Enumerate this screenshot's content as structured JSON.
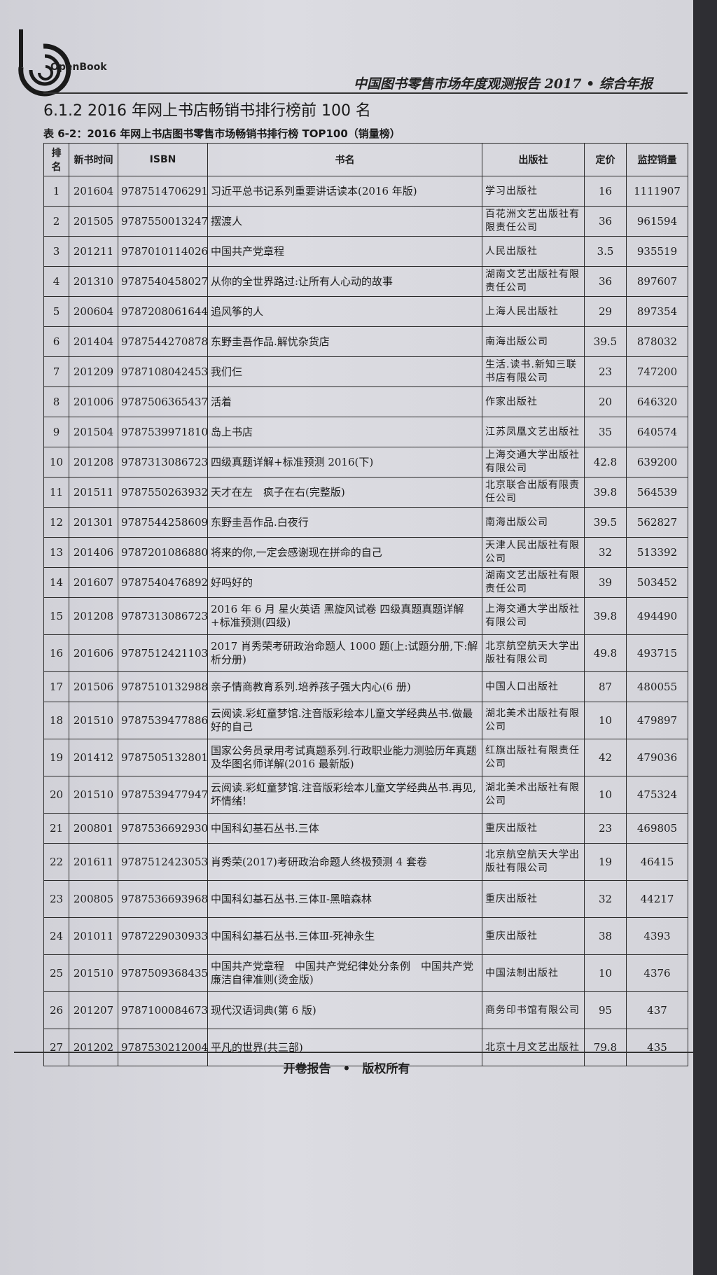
{
  "header": {
    "logo_text": "OpenBook",
    "report_title": "中国图书零售市场年度观测报告 2017 • 综合年报"
  },
  "section_title": "6.1.2 2016 年网上书店畅销书排行榜前 100 名",
  "table_caption": "表 6-2：2016 年网上书店图书零售市场畅销书排行榜 TOP100（销量榜）",
  "columns": [
    "排名",
    "新书时间",
    "ISBN",
    "书名",
    "出版社",
    "定价",
    "监控销量"
  ],
  "rows": [
    {
      "rank": "1",
      "date": "201604",
      "isbn": "9787514706291",
      "title": "习近平总书记系列重要讲话读本(2016 年版)",
      "publisher": "学习出版社",
      "price": "16",
      "sales": "1111907"
    },
    {
      "rank": "2",
      "date": "201505",
      "isbn": "9787550013247",
      "title": "摆渡人",
      "publisher": "百花洲文艺出版社有限责任公司",
      "price": "36",
      "sales": "961594"
    },
    {
      "rank": "3",
      "date": "201211",
      "isbn": "9787010114026",
      "title": "中国共产党章程",
      "publisher": "人民出版社",
      "price": "3.5",
      "sales": "935519"
    },
    {
      "rank": "4",
      "date": "201310",
      "isbn": "9787540458027",
      "title": "从你的全世界路过:让所有人心动的故事",
      "publisher": "湖南文艺出版社有限责任公司",
      "price": "36",
      "sales": "897607"
    },
    {
      "rank": "5",
      "date": "200604",
      "isbn": "9787208061644",
      "title": "追风筝的人",
      "publisher": "上海人民出版社",
      "price": "29",
      "sales": "897354"
    },
    {
      "rank": "6",
      "date": "201404",
      "isbn": "9787544270878",
      "title": "东野圭吾作品.解忧杂货店",
      "publisher": "南海出版公司",
      "price": "39.5",
      "sales": "878032"
    },
    {
      "rank": "7",
      "date": "201209",
      "isbn": "9787108042453",
      "title": "我们仨",
      "publisher": "生活.读书.新知三联书店有限公司",
      "price": "23",
      "sales": "747200"
    },
    {
      "rank": "8",
      "date": "201006",
      "isbn": "9787506365437",
      "title": "活着",
      "publisher": "作家出版社",
      "price": "20",
      "sales": "646320"
    },
    {
      "rank": "9",
      "date": "201504",
      "isbn": "9787539971810",
      "title": "岛上书店",
      "publisher": "江苏凤凰文艺出版社",
      "price": "35",
      "sales": "640574"
    },
    {
      "rank": "10",
      "date": "201208",
      "isbn": "9787313086723",
      "title": "四级真题详解+标准预测 2016(下)",
      "publisher": "上海交通大学出版社有限公司",
      "price": "42.8",
      "sales": "639200"
    },
    {
      "rank": "11",
      "date": "201511",
      "isbn": "9787550263932",
      "title": "天才在左　疯子在右(完整版)",
      "publisher": "北京联合出版有限责任公司",
      "price": "39.8",
      "sales": "564539"
    },
    {
      "rank": "12",
      "date": "201301",
      "isbn": "9787544258609",
      "title": "东野圭吾作品.白夜行",
      "publisher": "南海出版公司",
      "price": "39.5",
      "sales": "562827"
    },
    {
      "rank": "13",
      "date": "201406",
      "isbn": "9787201086880",
      "title": "将来的你,一定会感谢现在拼命的自己",
      "publisher": "天津人民出版社有限公司",
      "price": "32",
      "sales": "513392"
    },
    {
      "rank": "14",
      "date": "201607",
      "isbn": "9787540476892",
      "title": "好吗好的",
      "publisher": "湖南文艺出版社有限责任公司",
      "price": "39",
      "sales": "503452"
    },
    {
      "rank": "15",
      "date": "201208",
      "isbn": "9787313086723",
      "title": "2016 年 6 月 星火英语 黑旋风试卷 四级真题真题详解+标准预测(四级)",
      "publisher": "上海交通大学出版社有限公司",
      "price": "39.8",
      "sales": "494490"
    },
    {
      "rank": "16",
      "date": "201606",
      "isbn": "9787512421103",
      "title": "2017 肖秀荣考研政治命题人 1000 题(上:试题分册,下:解析分册)",
      "publisher": "北京航空航天大学出版社有限公司",
      "price": "49.8",
      "sales": "493715"
    },
    {
      "rank": "17",
      "date": "201506",
      "isbn": "9787510132988",
      "title": "亲子情商教育系列.培养孩子强大内心(6 册)",
      "publisher": "中国人口出版社",
      "price": "87",
      "sales": "480055"
    },
    {
      "rank": "18",
      "date": "201510",
      "isbn": "9787539477886",
      "title": "云阅读.彩虹童梦馆.注音版彩绘本儿童文学经典丛书.做最好的自己",
      "publisher": "湖北美术出版社有限公司",
      "price": "10",
      "sales": "479897"
    },
    {
      "rank": "19",
      "date": "201412",
      "isbn": "9787505132801",
      "title": "国家公务员录用考试真题系列.行政职业能力测验历年真题及华图名师详解(2016 最新版)",
      "publisher": "红旗出版社有限责任公司",
      "price": "42",
      "sales": "479036"
    },
    {
      "rank": "20",
      "date": "201510",
      "isbn": "9787539477947",
      "title": "云阅读.彩虹童梦馆.注音版彩绘本儿童文学经典丛书.再见,坏情绪!",
      "publisher": "湖北美术出版社有限公司",
      "price": "10",
      "sales": "475324"
    },
    {
      "rank": "21",
      "date": "200801",
      "isbn": "9787536692930",
      "title": "中国科幻基石丛书.三体",
      "publisher": "重庆出版社",
      "price": "23",
      "sales": "469805"
    },
    {
      "rank": "22",
      "date": "201611",
      "isbn": "9787512423053",
      "title": "肖秀荣(2017)考研政治命题人终极预测 4 套卷",
      "publisher": "北京航空航天大学出版社有限公司",
      "price": "19",
      "sales": "46415"
    },
    {
      "rank": "23",
      "date": "200805",
      "isbn": "9787536693968",
      "title": "中国科幻基石丛书.三体Ⅱ-黑暗森林",
      "publisher": "重庆出版社",
      "price": "32",
      "sales": "44217"
    },
    {
      "rank": "24",
      "date": "201011",
      "isbn": "9787229030933",
      "title": "中国科幻基石丛书.三体Ⅲ-死神永生",
      "publisher": "重庆出版社",
      "price": "38",
      "sales": "4393"
    },
    {
      "rank": "25",
      "date": "201510",
      "isbn": "9787509368435",
      "title": "中国共产党章程　中国共产党纪律处分条例　中国共产党廉洁自律准则(烫金版)",
      "publisher": "中国法制出版社",
      "price": "10",
      "sales": "4376"
    },
    {
      "rank": "26",
      "date": "201207",
      "isbn": "9787100084673",
      "title": "现代汉语词典(第 6 版)",
      "publisher": "商务印书馆有限公司",
      "price": "95",
      "sales": "437"
    },
    {
      "rank": "27",
      "date": "201202",
      "isbn": "9787530212004",
      "title": "平凡的世界(共三部)",
      "publisher": "北京十月文艺出版社",
      "price": "79.8",
      "sales": "435"
    }
  ],
  "footer": "开卷报告　•　版权所有"
}
